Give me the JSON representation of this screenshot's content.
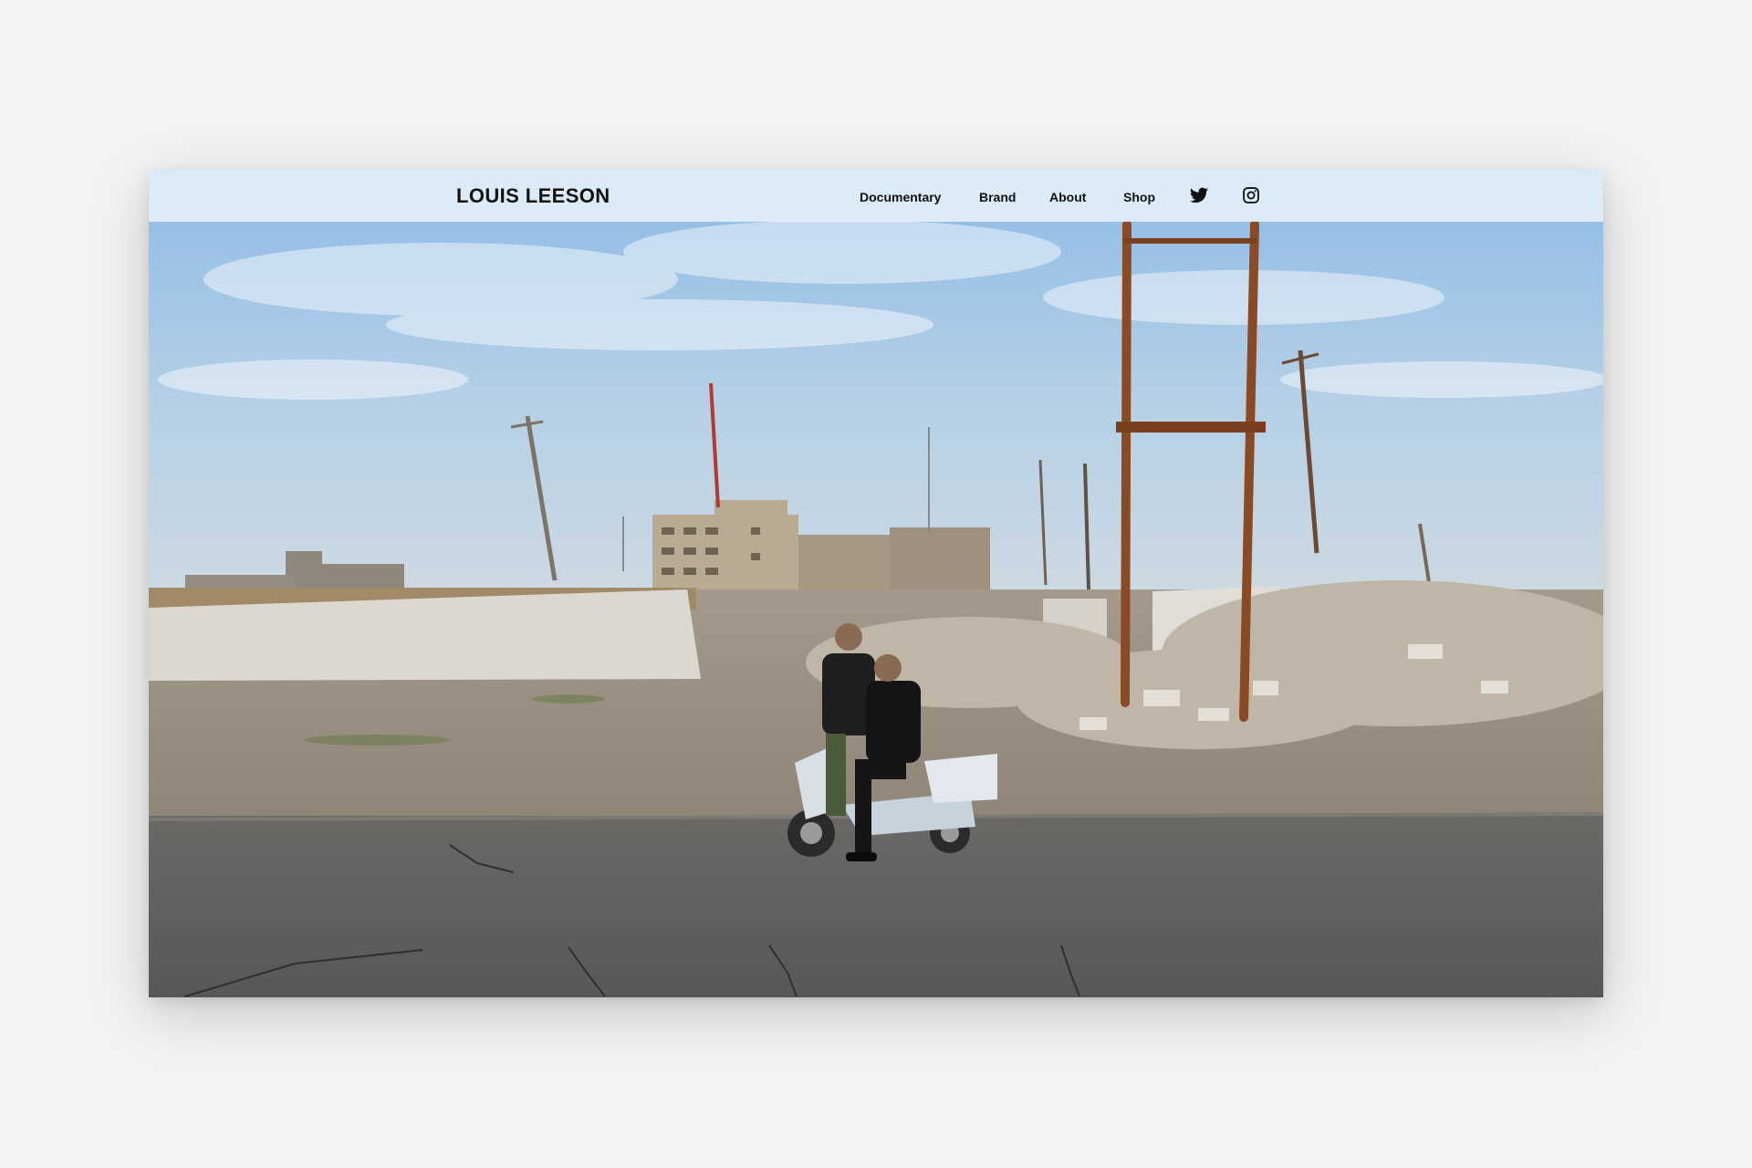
{
  "site": {
    "logo": "LOUIS LEESON"
  },
  "nav": {
    "items": [
      {
        "label": "Documentary"
      },
      {
        "label": "Brand"
      },
      {
        "label": "About"
      },
      {
        "label": "Shop"
      }
    ],
    "social": [
      {
        "icon": "twitter-icon"
      },
      {
        "icon": "instagram-icon"
      }
    ]
  },
  "hero": {
    "description": "Documentary photograph: two men with a scooter on a road in front of ruined buildings, rubble and rusted electricity poles"
  },
  "colors": {
    "page_background": "#f2f3f5",
    "header_background": "#e2eef9",
    "text": "#111111",
    "sky": "#9cc3e6",
    "road": "#5e5d5b"
  }
}
